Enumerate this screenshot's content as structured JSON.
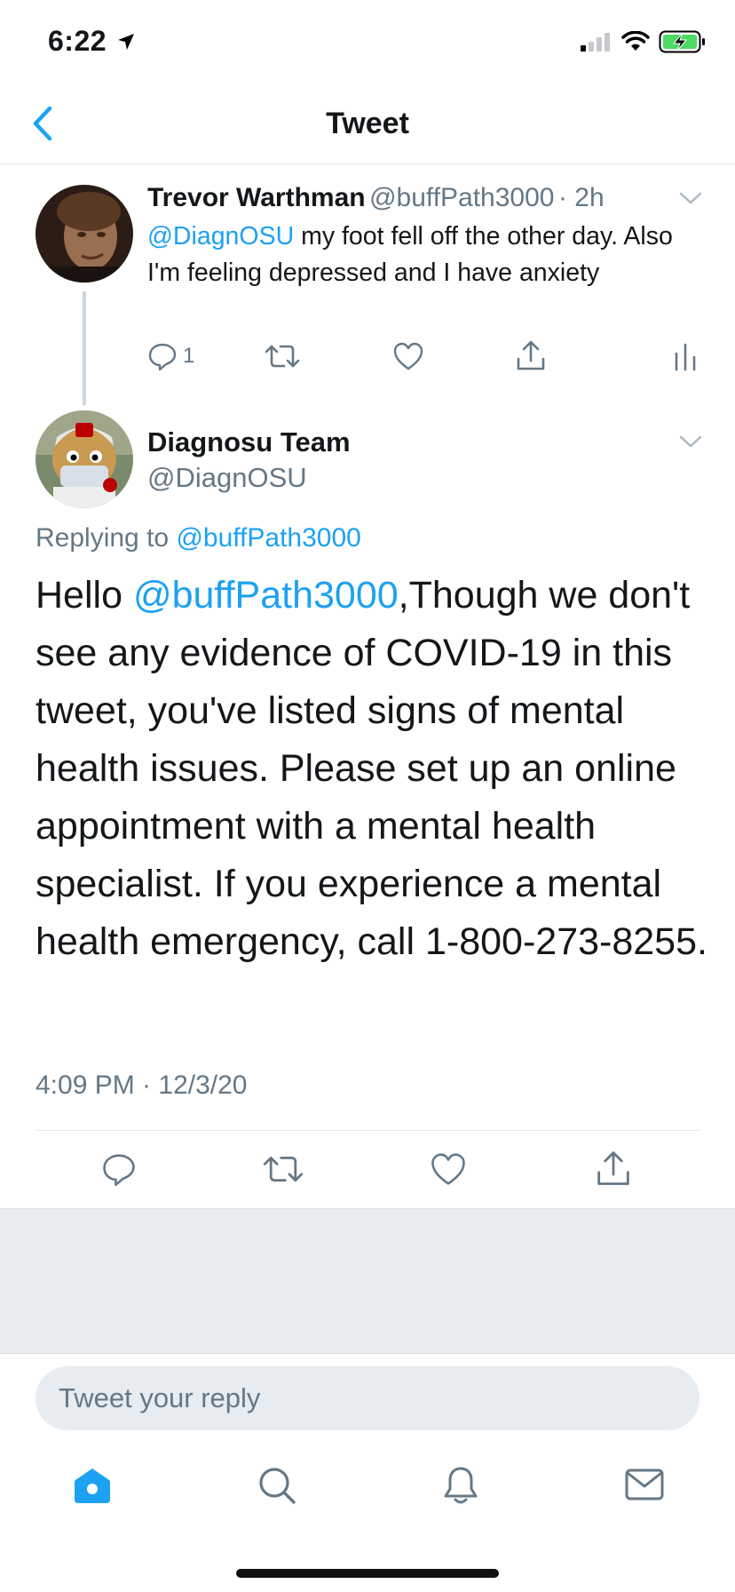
{
  "status": {
    "time": "6:22"
  },
  "header": {
    "title": "Tweet"
  },
  "parent_tweet": {
    "name": "Trevor Warthman",
    "handle": "@buffPath3000",
    "time": "· 2h",
    "mention": "@DiagnOSU",
    "text": " my foot fell off the other day. Also I'm feeling depressed and I have anxiety",
    "reply_count": "1"
  },
  "main_tweet": {
    "name": "Diagnosu Team",
    "handle": "@DiagnOSU",
    "replying_prefix": "Replying to ",
    "replying_handle": "@buffPath3000",
    "text_prefix": "Hello ",
    "text_mention": "@buffPath3000",
    "text_body": ",Though we don't see any evidence of COVID-19 in this tweet, you've listed signs of mental health issues. Please set up an online appointment with a mental health specialist. If you experience a mental health emergency, call 1-800-273-8255.",
    "timestamp": "4:09 PM · 12/3/20"
  },
  "reply": {
    "placeholder": "Tweet your reply"
  },
  "colors": {
    "accent": "#1da1f2",
    "secondary_text": "#657786",
    "battery": "#4cd964"
  },
  "icons": [
    "location-arrow-icon",
    "signal-icon",
    "wifi-icon",
    "battery-charging-icon",
    "back-chevron-icon",
    "chevron-down-icon",
    "reply-icon",
    "retweet-icon",
    "like-icon",
    "share-icon",
    "analytics-icon",
    "home-icon",
    "search-icon",
    "bell-icon",
    "mail-icon"
  ]
}
